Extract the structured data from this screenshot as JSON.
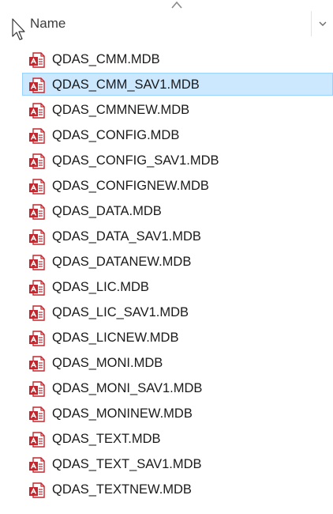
{
  "header": {
    "column_name": "Name"
  },
  "files": [
    {
      "name": "QDAS_CMM.MDB",
      "selected": false
    },
    {
      "name": "QDAS_CMM_SAV1.MDB",
      "selected": true
    },
    {
      "name": "QDAS_CMMNEW.MDB",
      "selected": false
    },
    {
      "name": "QDAS_CONFIG.MDB",
      "selected": false
    },
    {
      "name": "QDAS_CONFIG_SAV1.MDB",
      "selected": false
    },
    {
      "name": "QDAS_CONFIGNEW.MDB",
      "selected": false
    },
    {
      "name": "QDAS_DATA.MDB",
      "selected": false
    },
    {
      "name": "QDAS_DATA_SAV1.MDB",
      "selected": false
    },
    {
      "name": "QDAS_DATANEW.MDB",
      "selected": false
    },
    {
      "name": "QDAS_LIC.MDB",
      "selected": false
    },
    {
      "name": "QDAS_LIC_SAV1.MDB",
      "selected": false
    },
    {
      "name": "QDAS_LICNEW.MDB",
      "selected": false
    },
    {
      "name": "QDAS_MONI.MDB",
      "selected": false
    },
    {
      "name": "QDAS_MONI_SAV1.MDB",
      "selected": false
    },
    {
      "name": "QDAS_MONINEW.MDB",
      "selected": false
    },
    {
      "name": "QDAS_TEXT.MDB",
      "selected": false
    },
    {
      "name": "QDAS_TEXT_SAV1.MDB",
      "selected": false
    },
    {
      "name": "QDAS_TEXTNEW.MDB",
      "selected": false
    }
  ],
  "colors": {
    "selection_fill": "#cce8ff",
    "selection_border": "#99d1ff",
    "icon_accent": "#c4262e"
  },
  "icons": {
    "file": "access-database-file-icon",
    "sort": "sort-ascending-icon",
    "dropdown": "chevron-down-icon",
    "cursor": "mouse-pointer-icon"
  }
}
